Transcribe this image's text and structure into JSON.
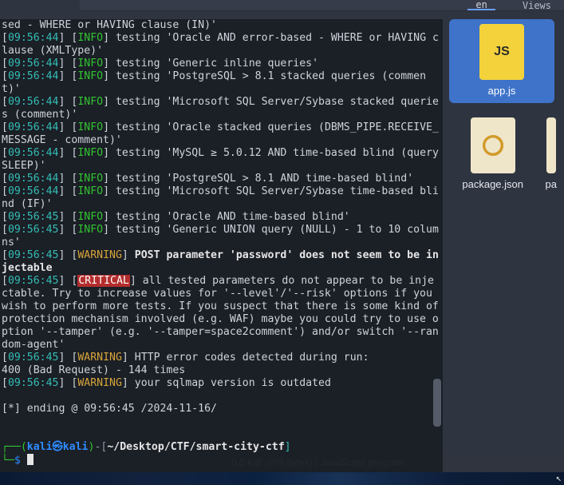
{
  "fm": {
    "tabs": {
      "active_label": "en",
      "view_label": "Views"
    },
    "files": {
      "appjs": {
        "label": "app.js"
      },
      "packagejson": {
        "label": "package.json"
      },
      "cut_label": "pa"
    },
    "status": {
      "text": "0.0 KiB (278 bytes) | JavaScript program"
    }
  },
  "term": {
    "lines": [
      {
        "plain": "sed - WHERE or HAVING clause (IN)'"
      },
      {
        "ts": "09:56:44",
        "level": "INFO",
        "text": " testing 'Oracle AND error-based - WHERE or HAVING clause (XMLType)'"
      },
      {
        "ts": "09:56:44",
        "level": "INFO",
        "text": " testing 'Generic inline queries'"
      },
      {
        "ts": "09:56:44",
        "level": "INFO",
        "text": " testing 'PostgreSQL > 8.1 stacked queries (comment)'"
      },
      {
        "ts": "09:56:44",
        "level": "INFO",
        "text": " testing 'Microsoft SQL Server/Sybase stacked queries (comment)'"
      },
      {
        "ts": "09:56:44",
        "level": "INFO",
        "text": " testing 'Oracle stacked queries (DBMS_PIPE.RECEIVE_MESSAGE - comment)'"
      },
      {
        "ts": "09:56:44",
        "level": "INFO",
        "text": " testing 'MySQL ≥ 5.0.12 AND time-based blind (query SLEEP)'"
      },
      {
        "ts": "09:56:44",
        "level": "INFO",
        "text": " testing 'PostgreSQL > 8.1 AND time-based blind'"
      },
      {
        "ts": "09:56:44",
        "level": "INFO",
        "text": " testing 'Microsoft SQL Server/Sybase time-based blind (IF)'"
      },
      {
        "ts": "09:56:45",
        "level": "INFO",
        "text": " testing 'Oracle AND time-based blind'"
      },
      {
        "ts": "09:56:45",
        "level": "INFO",
        "text": " testing 'Generic UNION query (NULL) - 1 to 10 columns'"
      },
      {
        "ts": "09:56:45",
        "level": "WARNING",
        "bold_text": " POST parameter 'password' does not seem to be injectable"
      },
      {
        "ts": "09:56:45",
        "level": "CRITICAL",
        "text": " all tested parameters do not appear to be injectable. Try to increase values for '--level'/'--risk' options if you wish to perform more tests. If you suspect that there is some kind of protection mechanism involved (e.g. WAF) maybe you could try to use option '--tamper' (e.g. '--tamper=space2comment') and/or switch '--random-agent'"
      },
      {
        "ts": "09:56:45",
        "level": "WARNING",
        "text": " HTTP error codes detected during run:\n400 (Bad Request) - 144 times"
      },
      {
        "ts": "09:56:45",
        "level": "WARNING",
        "text": " your sqlmap version is outdated"
      },
      {
        "plain": ""
      },
      {
        "plain": "[*] ending @ 09:56:45 /2024-11-16/"
      },
      {
        "plain": ""
      }
    ],
    "prompt": {
      "box_top": "┌──",
      "paren_open": "(",
      "user": "kali",
      "at": "㉿",
      "host": "kali",
      "paren_close": ")",
      "dash": "-",
      "brkt_open": "[",
      "path": "~/Desktop/CTF/smart-city-ctf",
      "brkt_close": "]",
      "box_bottom": "└─",
      "dollar": "$"
    }
  }
}
